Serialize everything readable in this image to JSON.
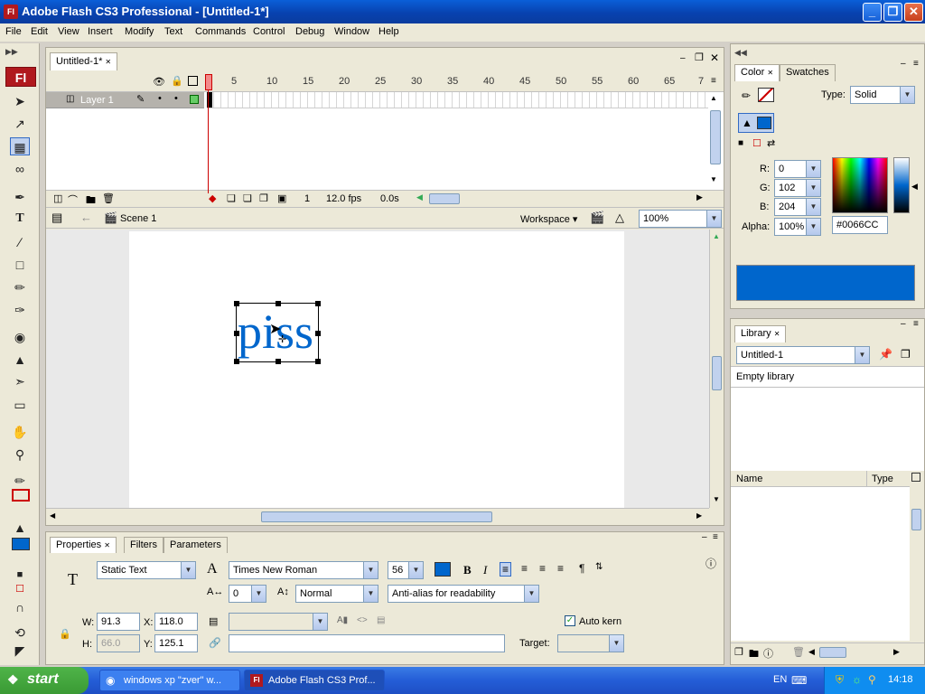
{
  "window": {
    "title": "Adobe Flash CS3 Professional - [Untitled-1*]",
    "app_icon": "Fl"
  },
  "menu": [
    "File",
    "Edit",
    "View",
    "Insert",
    "Modify",
    "Text",
    "Commands",
    "Control",
    "Debug",
    "Window",
    "Help"
  ],
  "tools_logo": "Fl",
  "document": {
    "tab": "Untitled-1*",
    "layer_name": "Layer 1",
    "frame_numbers": [
      "1",
      "5",
      "10",
      "15",
      "20",
      "25",
      "30",
      "35",
      "40",
      "45",
      "50",
      "55",
      "60",
      "65",
      "7"
    ],
    "current_frame": "1",
    "fps": "12.0 fps",
    "time": "0.0s",
    "scene": "Scene 1",
    "workspace_label": "Workspace ▾",
    "zoom": "100%",
    "stage_text": "piss",
    "stage_text_color": "#0066CC"
  },
  "properties": {
    "tabs": [
      "Properties",
      "Filters",
      "Parameters"
    ],
    "text_type": "Static Text",
    "font": "Times New Roman",
    "size": "56",
    "bold": "B",
    "italic": "I",
    "letter_spacing": "0",
    "char_position": "Normal",
    "anti_alias": "Anti-alias for readability",
    "w_label": "W:",
    "w": "91.3",
    "x_label": "X:",
    "x": "118.0",
    "h_label": "H:",
    "h": "66.0",
    "y_label": "Y:",
    "y": "125.1",
    "auto_kern": "Auto kern",
    "target_label": "Target:"
  },
  "color_panel": {
    "tabs": [
      "Color",
      "Swatches"
    ],
    "type_label": "Type:",
    "type": "Solid",
    "r_label": "R:",
    "r": "0",
    "g_label": "G:",
    "g": "102",
    "b_label": "B:",
    "b": "204",
    "alpha_label": "Alpha:",
    "alpha": "100%",
    "hex": "#0066CC"
  },
  "library_panel": {
    "tab": "Library",
    "document": "Untitled-1",
    "status": "Empty library",
    "col_name": "Name",
    "col_type": "Type"
  },
  "taskbar": {
    "start": "start",
    "items": [
      "windows xp \"zver\" w...",
      "Adobe Flash CS3 Prof..."
    ],
    "lang": "EN",
    "clock": "14:18"
  }
}
